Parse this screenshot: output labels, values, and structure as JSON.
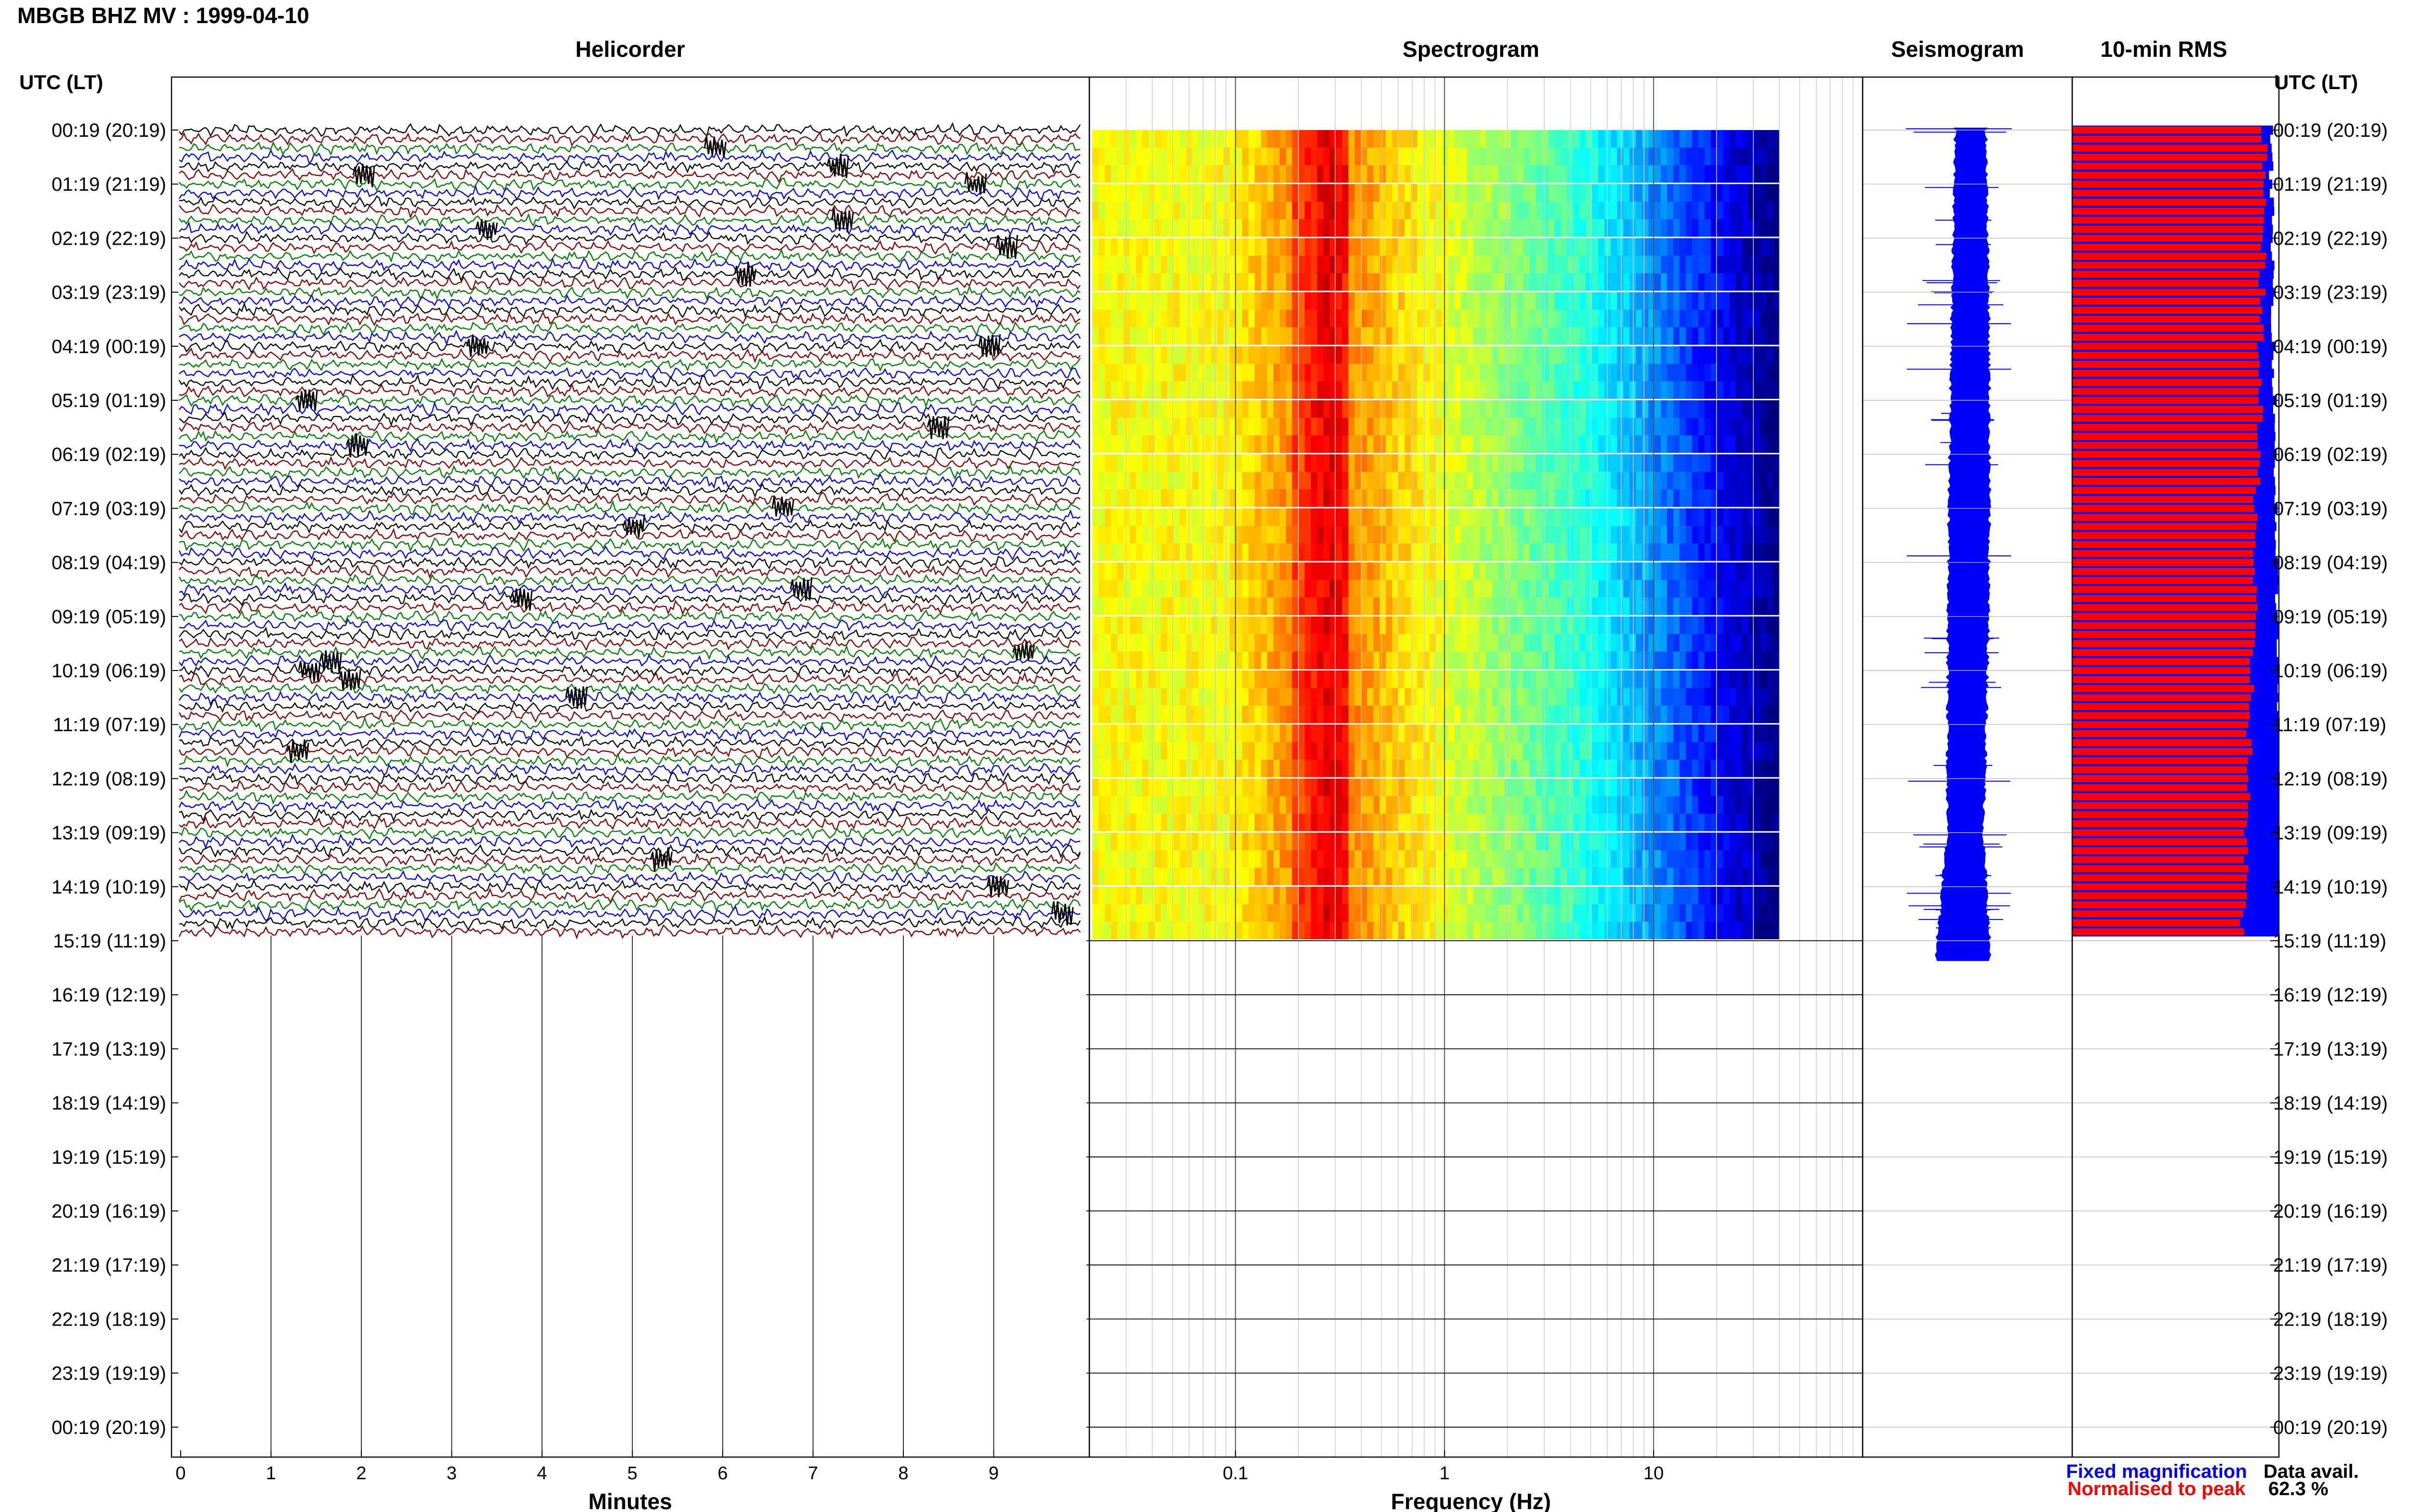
{
  "header": {
    "title": "MBGB BHZ MV : 1999-04-10",
    "time_axis_label_left": "UTC (LT)",
    "time_axis_label_right": "UTC (LT)"
  },
  "panels": {
    "helicorder": "Helicorder",
    "spectrogram": "Spectrogram",
    "seismogram": "Seismogram",
    "rms": "10-min RMS"
  },
  "legend": {
    "fixed": "Fixed magnification",
    "normalised": "Normalised to peak",
    "fixed_color": "#0000ff",
    "normalised_color": "#ff0000"
  },
  "data_availability": {
    "label": "Data avail.",
    "value": "62.3 %"
  },
  "colors": {
    "trace_cycle": [
      "#000000",
      "#8b0000",
      "#008000",
      "#0000ff"
    ],
    "seismogram": "#0000ff",
    "rms_normalised": "#ff0000",
    "rms_fixed": "#0000ff"
  },
  "chart_data": [
    {
      "type": "line",
      "panel": "helicorder",
      "xlabel": "Minutes",
      "xlim": [
        0,
        10
      ],
      "x_ticks": [
        "0",
        "1",
        "2",
        "3",
        "4",
        "5",
        "6",
        "7",
        "8",
        "9"
      ],
      "row_interval_minutes": 10,
      "rows_recorded": 90,
      "data_available_percent": 62.3
    },
    {
      "type": "heatmap",
      "panel": "spectrogram",
      "xlabel": "Frequency (Hz)",
      "x_scale": "log",
      "xlim": [
        0.02,
        100
      ],
      "x_ticks": [
        "0.1",
        "1",
        "10"
      ],
      "band_max_hz": 40,
      "peak_energy_hz": [
        0.2,
        0.35
      ]
    },
    {
      "type": "area",
      "panel": "seismogram"
    },
    {
      "type": "bar",
      "panel": "10-min RMS",
      "series": [
        {
          "name": "Fixed magnification"
        },
        {
          "name": "Normalised to peak"
        }
      ]
    }
  ],
  "time_axis": {
    "utc": [
      "00:19",
      "01:19",
      "02:19",
      "03:19",
      "04:19",
      "05:19",
      "06:19",
      "07:19",
      "08:19",
      "09:19",
      "10:19",
      "11:19",
      "12:19",
      "13:19",
      "14:19",
      "15:19",
      "16:19",
      "17:19",
      "18:19",
      "19:19",
      "20:19",
      "21:19",
      "22:19",
      "23:19",
      "00:19"
    ],
    "lt": [
      "20:19",
      "21:19",
      "22:19",
      "23:19",
      "00:19",
      "01:19",
      "02:19",
      "03:19",
      "04:19",
      "05:19",
      "06:19",
      "07:19",
      "08:19",
      "09:19",
      "10:19",
      "11:19",
      "12:19",
      "13:19",
      "14:19",
      "15:19",
      "16:19",
      "17:19",
      "18:19",
      "19:19",
      "20:19"
    ]
  }
}
